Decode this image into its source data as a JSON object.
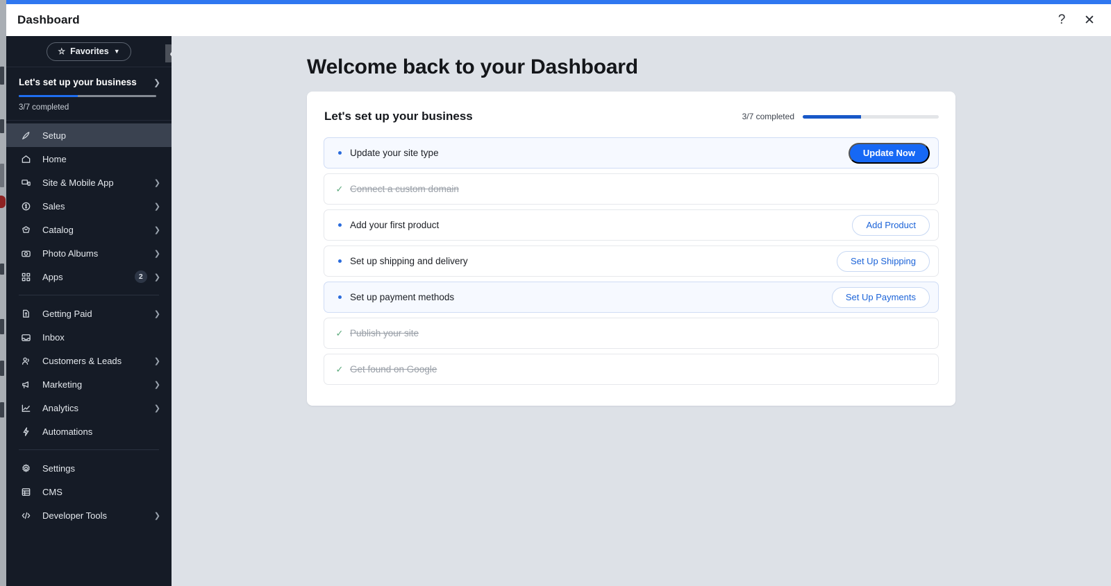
{
  "window": {
    "title": "Dashboard",
    "help_icon": "question-mark-icon",
    "close_icon": "close-icon"
  },
  "sidebar": {
    "favorites": {
      "label": "Favorites",
      "star_icon": "star-icon",
      "caret_icon": "chevron-down-icon"
    },
    "setup_panel": {
      "title": "Let's set up your business",
      "progress_text": "3/7 completed",
      "progress_percent": 43,
      "chevron_icon": "chevron-right-icon"
    },
    "collapse_icon": "chevron-left-icon",
    "items": [
      {
        "label": "Setup",
        "icon": "rocket-icon",
        "active": true,
        "chevron": false,
        "badge": ""
      },
      {
        "label": "Home",
        "icon": "home-icon",
        "active": false,
        "chevron": false,
        "badge": ""
      },
      {
        "label": "Site & Mobile App",
        "icon": "monitor-icon",
        "active": false,
        "chevron": true,
        "badge": ""
      },
      {
        "label": "Sales",
        "icon": "coin-icon",
        "active": false,
        "chevron": true,
        "badge": ""
      },
      {
        "label": "Catalog",
        "icon": "tag-icon",
        "active": false,
        "chevron": true,
        "badge": ""
      },
      {
        "label": "Photo Albums",
        "icon": "camera-icon",
        "active": false,
        "chevron": true,
        "badge": ""
      },
      {
        "label": "Apps",
        "icon": "apps-grid-icon",
        "active": false,
        "chevron": true,
        "badge": "2"
      },
      {
        "label": "Getting Paid",
        "icon": "invoice-icon",
        "active": false,
        "chevron": true,
        "badge": "",
        "separator_before": true
      },
      {
        "label": "Inbox",
        "icon": "inbox-icon",
        "active": false,
        "chevron": false,
        "badge": ""
      },
      {
        "label": "Customers & Leads",
        "icon": "people-icon",
        "active": false,
        "chevron": true,
        "badge": ""
      },
      {
        "label": "Marketing",
        "icon": "megaphone-icon",
        "active": false,
        "chevron": true,
        "badge": ""
      },
      {
        "label": "Analytics",
        "icon": "chart-line-icon",
        "active": false,
        "chevron": true,
        "badge": ""
      },
      {
        "label": "Automations",
        "icon": "bolt-icon",
        "active": false,
        "chevron": false,
        "badge": ""
      },
      {
        "label": "Settings",
        "icon": "gear-icon",
        "active": false,
        "chevron": false,
        "badge": "",
        "separator_before": true
      },
      {
        "label": "CMS",
        "icon": "table-icon",
        "active": false,
        "chevron": false,
        "badge": ""
      },
      {
        "label": "Developer Tools",
        "icon": "code-icon",
        "active": false,
        "chevron": true,
        "badge": ""
      }
    ]
  },
  "main": {
    "page_title": "Welcome back to your Dashboard",
    "card": {
      "title": "Let's set up your business",
      "progress_text": "3/7 completed",
      "progress_percent": 43,
      "tasks": [
        {
          "label": "Update your site type",
          "done": false,
          "highlight": true,
          "action": "Update Now",
          "action_style": "primary"
        },
        {
          "label": "Connect a custom domain",
          "done": true,
          "highlight": false,
          "action": "",
          "action_style": ""
        },
        {
          "label": "Add your first product",
          "done": false,
          "highlight": false,
          "action": "Add Product",
          "action_style": "ghost"
        },
        {
          "label": "Set up shipping and delivery",
          "done": false,
          "highlight": false,
          "action": "Set Up Shipping",
          "action_style": "ghost"
        },
        {
          "label": "Set up payment methods",
          "done": false,
          "highlight": true,
          "action": "Set Up Payments",
          "action_style": "ghost"
        },
        {
          "label": "Publish your site",
          "done": true,
          "highlight": false,
          "action": "",
          "action_style": ""
        },
        {
          "label": "Get found on Google",
          "done": true,
          "highlight": false,
          "action": "",
          "action_style": ""
        }
      ]
    }
  },
  "colors": {
    "accent_blue": "#1668f5",
    "progress_blue": "#1858c8",
    "sidebar_bg": "#151b26",
    "page_bg": "#dde1e7",
    "check_green": "#5aa97a"
  }
}
